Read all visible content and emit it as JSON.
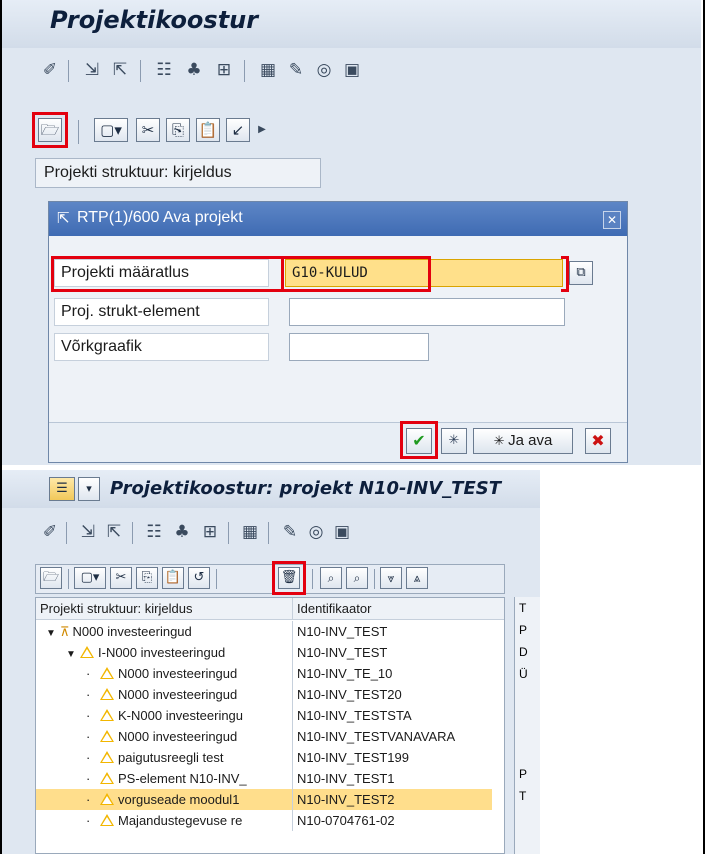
{
  "panel1": {
    "title": "Projektikoostur",
    "tree_header": "Projekti struktuur: kirjeldus",
    "dialog": {
      "title": "RTP(1)/600 Ava projekt",
      "close_glyph": "✕",
      "fields": [
        {
          "label": "Projekti määratlus",
          "value": "G10-KULUD"
        },
        {
          "label": "Proj. strukt-element",
          "value": ""
        },
        {
          "label": "Võrkgraafik",
          "value": ""
        }
      ],
      "open_and_label": "Ja ava"
    }
  },
  "panel2": {
    "title": "Projektikoostur: projekt N10-INV_TEST",
    "tree": {
      "col1_header": "Projekti struktuur: kirjeldus",
      "col2_header": "Identifikaator",
      "rows": [
        {
          "desc": "N000 investeeringud",
          "id": "N10-INV_TEST",
          "level": 0,
          "expander": "▼",
          "icon": "project-icon",
          "selected": false
        },
        {
          "desc": "I-N000 investeeringud",
          "id": "N10-INV_TEST",
          "level": 1,
          "expander": "▼",
          "icon": "wbs-element-icon",
          "selected": false
        },
        {
          "desc": "N000 investeeringud",
          "id": "N10-INV_TE_10",
          "level": 2,
          "expander": "·",
          "icon": "wbs-element-icon",
          "selected": false
        },
        {
          "desc": "N000 investeeringud",
          "id": "N10-INV_TEST20",
          "level": 2,
          "expander": "·",
          "icon": "wbs-element-icon",
          "selected": false
        },
        {
          "desc": "K-N000 investeeringu",
          "id": "N10-INV_TESTSTA",
          "level": 2,
          "expander": "·",
          "icon": "wbs-element-icon",
          "selected": false
        },
        {
          "desc": "N000 investeeringud",
          "id": "N10-INV_TESTVANAVARA",
          "level": 2,
          "expander": "·",
          "icon": "wbs-element-icon",
          "selected": false
        },
        {
          "desc": "paigutusreegli test",
          "id": "N10-INV_TEST199",
          "level": 2,
          "expander": "·",
          "icon": "wbs-element-icon",
          "selected": false
        },
        {
          "desc": "PS-element N10-INV_",
          "id": "N10-INV_TEST1",
          "level": 2,
          "expander": "·",
          "icon": "wbs-element-icon",
          "selected": false
        },
        {
          "desc": "vorguseade moodul1",
          "id": "N10-INV_TEST2",
          "level": 2,
          "expander": "·",
          "icon": "wbs-element-icon",
          "selected": true
        },
        {
          "desc": "Majandustegevuse re",
          "id": "N10-0704761-02",
          "level": 2,
          "expander": "·",
          "icon": "wbs-element-icon",
          "selected": false
        }
      ]
    },
    "side_letters": [
      "T",
      "P",
      "D",
      "Ü",
      "P",
      "T"
    ]
  },
  "colors": {
    "highlight_red": "#e3000f",
    "selected_row": "#ffde8c",
    "dialog_title": "#4a74ba",
    "warning_triangle": "#f2b600"
  }
}
